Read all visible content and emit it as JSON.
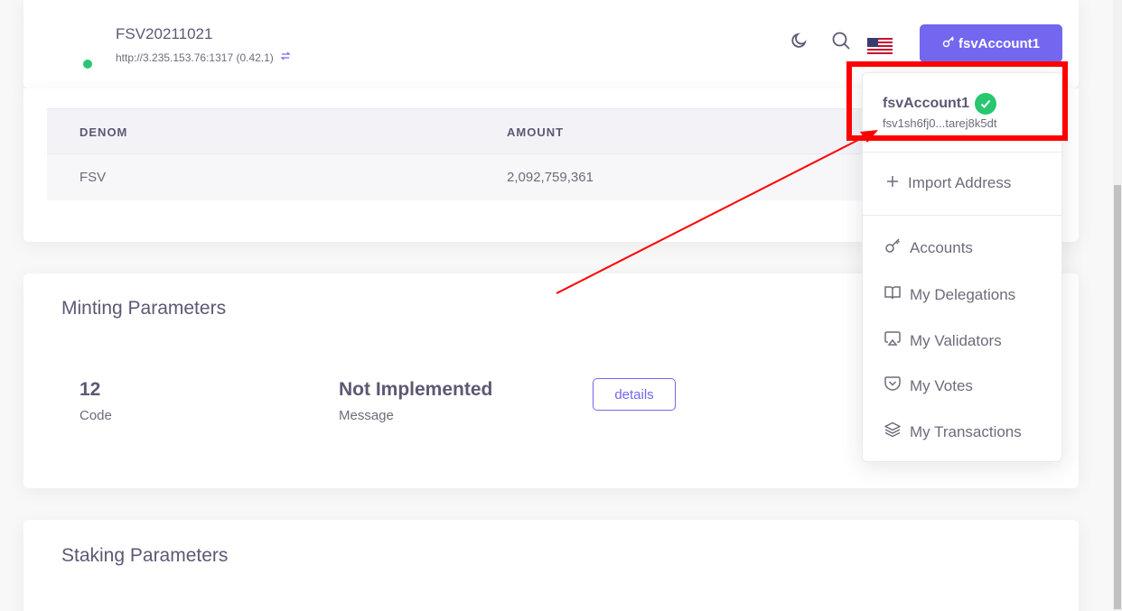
{
  "header": {
    "chain_name": "FSV20211021",
    "chain_url": "http://3.235.153.76:1317 (0.42.1)",
    "account_button_label": "fsvAccount1",
    "icons": [
      "moon-icon",
      "search-icon",
      "us-flag-icon",
      "key-icon",
      "sync-icon"
    ]
  },
  "balance_table": {
    "columns": [
      "DENOM",
      "AMOUNT"
    ],
    "rows": [
      {
        "denom": "FSV",
        "amount": "2,092,759,361"
      }
    ]
  },
  "minting": {
    "title": "Minting Parameters",
    "code_value": "12",
    "code_label": "Code",
    "message_value": "Not Implemented",
    "message_label": "Message",
    "details_label": "details"
  },
  "staking": {
    "title": "Staking Parameters"
  },
  "dropdown": {
    "account_name": "fsvAccount1",
    "account_address": "fsv1sh6fj0...tarej8k5dt",
    "import_label": "Import Address",
    "items": [
      {
        "label": "Accounts",
        "icon": "key-icon"
      },
      {
        "label": "My Delegations",
        "icon": "book-icon"
      },
      {
        "label": "My Validators",
        "icon": "airplay-icon"
      },
      {
        "label": "My Votes",
        "icon": "pocket-icon"
      },
      {
        "label": "My Transactions",
        "icon": "layers-icon"
      }
    ]
  },
  "colors": {
    "accent": "#7367f0",
    "success": "#28c76f",
    "annotation": "#ff0000"
  }
}
